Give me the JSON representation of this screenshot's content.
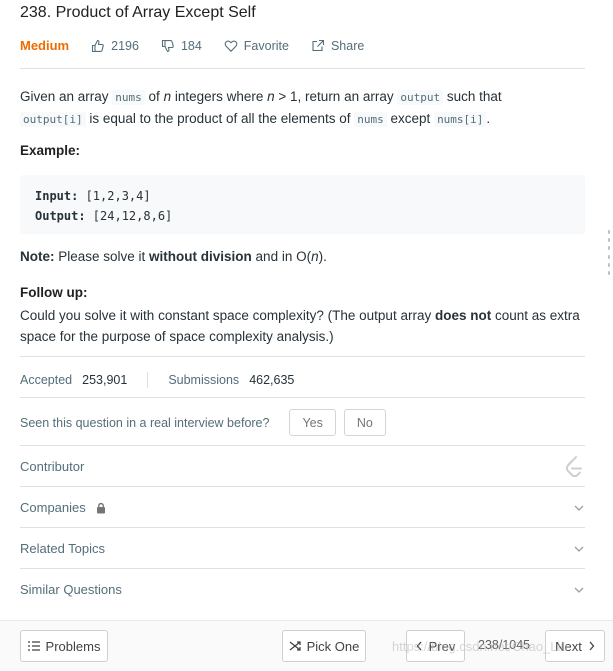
{
  "problem": {
    "title": "238. Product of Array Except Self",
    "difficulty": "Medium",
    "likes": "2196",
    "dislikes": "184",
    "favorite_label": "Favorite",
    "share_label": "Share"
  },
  "description": {
    "t1": "Given an array ",
    "c1": "nums",
    "t2": " of ",
    "i1": "n",
    "t3": " integers where ",
    "i2": "n",
    "t4": " > 1,  return an array ",
    "c2": "output",
    "t5": " such that",
    "c3": "output[i]",
    "t6": " is equal to the product of all the elements of ",
    "c4": "nums",
    "t7": " except ",
    "c5": "nums[i]",
    "t8": "."
  },
  "example": {
    "heading": "Example:",
    "input_label": "Input:",
    "input_value": " [1,2,3,4]",
    "output_label": "Output:",
    "output_value": " [24,12,8,6]"
  },
  "note": {
    "label": "Note:",
    "t1": " Please solve it ",
    "bold": "without division",
    "t2": " and in O(",
    "italic": "n",
    "t3": ")."
  },
  "follow_up": {
    "heading": "Follow up:",
    "t1": "Could you solve it with constant space complexity? (The output array ",
    "bold": "does not",
    "t2": " count as extra space for the purpose of space complexity analysis.)"
  },
  "stats": {
    "accepted_label": "Accepted",
    "accepted_value": "253,901",
    "submissions_label": "Submissions",
    "submissions_value": "462,635"
  },
  "interview": {
    "question": "Seen this question in a real interview before?",
    "yes": "Yes",
    "no": "No"
  },
  "sections": {
    "contributor": "Contributor",
    "companies": "Companies",
    "related_topics": "Related Topics",
    "similar_questions": "Similar Questions"
  },
  "footer": {
    "problems": "Problems",
    "pick_one": "Pick One",
    "prev": "Prev",
    "pager": "238/1045",
    "next": "Next"
  },
  "watermark": "https://blog.csdn.net/Chao_Liu",
  "colors": {
    "difficulty_medium": "#ef6c00",
    "text_muted": "#546e7a",
    "border": "#e0e0e0"
  }
}
